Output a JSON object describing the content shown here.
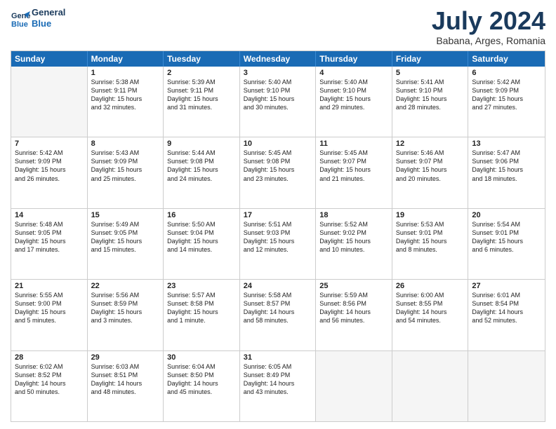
{
  "header": {
    "logo_line1": "General",
    "logo_line2": "Blue",
    "month": "July 2024",
    "location": "Babana, Arges, Romania"
  },
  "days_of_week": [
    "Sunday",
    "Monday",
    "Tuesday",
    "Wednesday",
    "Thursday",
    "Friday",
    "Saturday"
  ],
  "weeks": [
    [
      {
        "day": "",
        "lines": []
      },
      {
        "day": "1",
        "lines": [
          "Sunrise: 5:38 AM",
          "Sunset: 9:11 PM",
          "Daylight: 15 hours",
          "and 32 minutes."
        ]
      },
      {
        "day": "2",
        "lines": [
          "Sunrise: 5:39 AM",
          "Sunset: 9:11 PM",
          "Daylight: 15 hours",
          "and 31 minutes."
        ]
      },
      {
        "day": "3",
        "lines": [
          "Sunrise: 5:40 AM",
          "Sunset: 9:10 PM",
          "Daylight: 15 hours",
          "and 30 minutes."
        ]
      },
      {
        "day": "4",
        "lines": [
          "Sunrise: 5:40 AM",
          "Sunset: 9:10 PM",
          "Daylight: 15 hours",
          "and 29 minutes."
        ]
      },
      {
        "day": "5",
        "lines": [
          "Sunrise: 5:41 AM",
          "Sunset: 9:10 PM",
          "Daylight: 15 hours",
          "and 28 minutes."
        ]
      },
      {
        "day": "6",
        "lines": [
          "Sunrise: 5:42 AM",
          "Sunset: 9:09 PM",
          "Daylight: 15 hours",
          "and 27 minutes."
        ]
      }
    ],
    [
      {
        "day": "7",
        "lines": [
          "Sunrise: 5:42 AM",
          "Sunset: 9:09 PM",
          "Daylight: 15 hours",
          "and 26 minutes."
        ]
      },
      {
        "day": "8",
        "lines": [
          "Sunrise: 5:43 AM",
          "Sunset: 9:09 PM",
          "Daylight: 15 hours",
          "and 25 minutes."
        ]
      },
      {
        "day": "9",
        "lines": [
          "Sunrise: 5:44 AM",
          "Sunset: 9:08 PM",
          "Daylight: 15 hours",
          "and 24 minutes."
        ]
      },
      {
        "day": "10",
        "lines": [
          "Sunrise: 5:45 AM",
          "Sunset: 9:08 PM",
          "Daylight: 15 hours",
          "and 23 minutes."
        ]
      },
      {
        "day": "11",
        "lines": [
          "Sunrise: 5:45 AM",
          "Sunset: 9:07 PM",
          "Daylight: 15 hours",
          "and 21 minutes."
        ]
      },
      {
        "day": "12",
        "lines": [
          "Sunrise: 5:46 AM",
          "Sunset: 9:07 PM",
          "Daylight: 15 hours",
          "and 20 minutes."
        ]
      },
      {
        "day": "13",
        "lines": [
          "Sunrise: 5:47 AM",
          "Sunset: 9:06 PM",
          "Daylight: 15 hours",
          "and 18 minutes."
        ]
      }
    ],
    [
      {
        "day": "14",
        "lines": [
          "Sunrise: 5:48 AM",
          "Sunset: 9:05 PM",
          "Daylight: 15 hours",
          "and 17 minutes."
        ]
      },
      {
        "day": "15",
        "lines": [
          "Sunrise: 5:49 AM",
          "Sunset: 9:05 PM",
          "Daylight: 15 hours",
          "and 15 minutes."
        ]
      },
      {
        "day": "16",
        "lines": [
          "Sunrise: 5:50 AM",
          "Sunset: 9:04 PM",
          "Daylight: 15 hours",
          "and 14 minutes."
        ]
      },
      {
        "day": "17",
        "lines": [
          "Sunrise: 5:51 AM",
          "Sunset: 9:03 PM",
          "Daylight: 15 hours",
          "and 12 minutes."
        ]
      },
      {
        "day": "18",
        "lines": [
          "Sunrise: 5:52 AM",
          "Sunset: 9:02 PM",
          "Daylight: 15 hours",
          "and 10 minutes."
        ]
      },
      {
        "day": "19",
        "lines": [
          "Sunrise: 5:53 AM",
          "Sunset: 9:01 PM",
          "Daylight: 15 hours",
          "and 8 minutes."
        ]
      },
      {
        "day": "20",
        "lines": [
          "Sunrise: 5:54 AM",
          "Sunset: 9:01 PM",
          "Daylight: 15 hours",
          "and 6 minutes."
        ]
      }
    ],
    [
      {
        "day": "21",
        "lines": [
          "Sunrise: 5:55 AM",
          "Sunset: 9:00 PM",
          "Daylight: 15 hours",
          "and 5 minutes."
        ]
      },
      {
        "day": "22",
        "lines": [
          "Sunrise: 5:56 AM",
          "Sunset: 8:59 PM",
          "Daylight: 15 hours",
          "and 3 minutes."
        ]
      },
      {
        "day": "23",
        "lines": [
          "Sunrise: 5:57 AM",
          "Sunset: 8:58 PM",
          "Daylight: 15 hours",
          "and 1 minute."
        ]
      },
      {
        "day": "24",
        "lines": [
          "Sunrise: 5:58 AM",
          "Sunset: 8:57 PM",
          "Daylight: 14 hours",
          "and 58 minutes."
        ]
      },
      {
        "day": "25",
        "lines": [
          "Sunrise: 5:59 AM",
          "Sunset: 8:56 PM",
          "Daylight: 14 hours",
          "and 56 minutes."
        ]
      },
      {
        "day": "26",
        "lines": [
          "Sunrise: 6:00 AM",
          "Sunset: 8:55 PM",
          "Daylight: 14 hours",
          "and 54 minutes."
        ]
      },
      {
        "day": "27",
        "lines": [
          "Sunrise: 6:01 AM",
          "Sunset: 8:54 PM",
          "Daylight: 14 hours",
          "and 52 minutes."
        ]
      }
    ],
    [
      {
        "day": "28",
        "lines": [
          "Sunrise: 6:02 AM",
          "Sunset: 8:52 PM",
          "Daylight: 14 hours",
          "and 50 minutes."
        ]
      },
      {
        "day": "29",
        "lines": [
          "Sunrise: 6:03 AM",
          "Sunset: 8:51 PM",
          "Daylight: 14 hours",
          "and 48 minutes."
        ]
      },
      {
        "day": "30",
        "lines": [
          "Sunrise: 6:04 AM",
          "Sunset: 8:50 PM",
          "Daylight: 14 hours",
          "and 45 minutes."
        ]
      },
      {
        "day": "31",
        "lines": [
          "Sunrise: 6:05 AM",
          "Sunset: 8:49 PM",
          "Daylight: 14 hours",
          "and 43 minutes."
        ]
      },
      {
        "day": "",
        "lines": []
      },
      {
        "day": "",
        "lines": []
      },
      {
        "day": "",
        "lines": []
      }
    ]
  ]
}
